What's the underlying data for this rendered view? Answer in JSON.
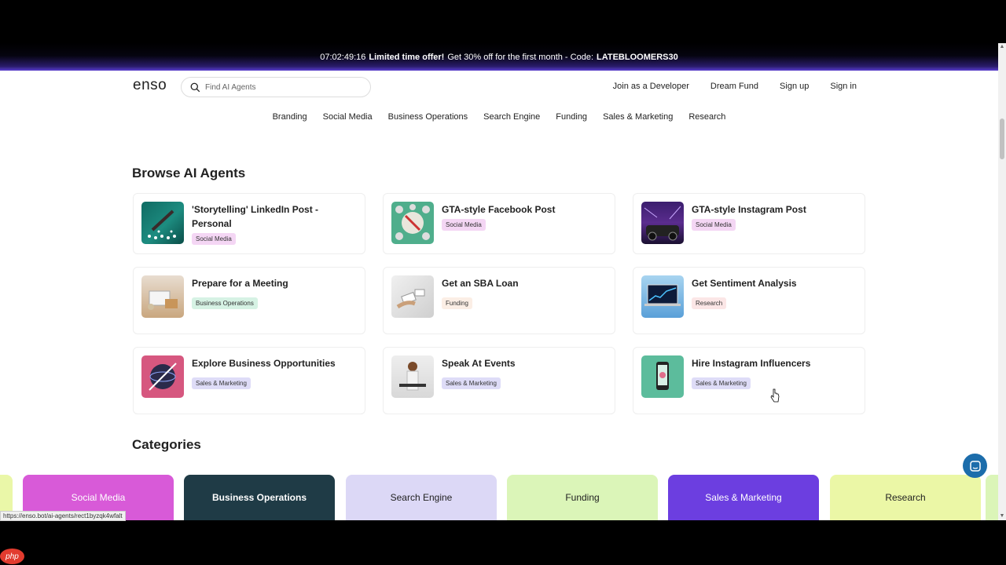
{
  "promo": {
    "timer": "07:02:49:16",
    "offer": "Limited time offer!",
    "text": "Get 30% off for the first month - Code:",
    "code": "LATEBLOOMERS30"
  },
  "header": {
    "logo": "enso",
    "search_placeholder": "Find AI Agents",
    "links": [
      "Join as a Developer",
      "Dream Fund",
      "Sign up",
      "Sign in"
    ]
  },
  "categories_nav": [
    "Branding",
    "Social Media",
    "Business Operations",
    "Search Engine",
    "Funding",
    "Sales & Marketing",
    "Research"
  ],
  "browse": {
    "title": "Browse AI Agents",
    "agents": [
      {
        "title": "'Storytelling' LinkedIn Post - Personal",
        "tag": "Social Media"
      },
      {
        "title": "GTA-style Facebook Post",
        "tag": "Social Media"
      },
      {
        "title": "GTA-style Instagram Post",
        "tag": "Social Media"
      },
      {
        "title": "Prepare for a Meeting",
        "tag": "Business Operations"
      },
      {
        "title": "Get an SBA Loan",
        "tag": "Funding"
      },
      {
        "title": "Get Sentiment Analysis",
        "tag": "Research"
      },
      {
        "title": "Explore Business Opportunities",
        "tag": "Sales & Marketing"
      },
      {
        "title": "Speak At Events",
        "tag": "Sales & Marketing"
      },
      {
        "title": "Hire Instagram Influencers",
        "tag": "Sales & Marketing"
      }
    ]
  },
  "categories": {
    "title": "Categories",
    "items": [
      "Social Media",
      "Business Operations",
      "Search Engine",
      "Funding",
      "Sales & Marketing",
      "Research"
    ]
  },
  "status_url": "https://enso.bot/ai-agents/rect1byzqk4wfalt",
  "badge": "php",
  "colors": {
    "tag_social": "#f4d6f4",
    "tag_business": "#d6f2e4",
    "tag_funding": "#fbeee5",
    "tag_research": "#fbe6e6",
    "tag_sales": "#dedcf7"
  }
}
